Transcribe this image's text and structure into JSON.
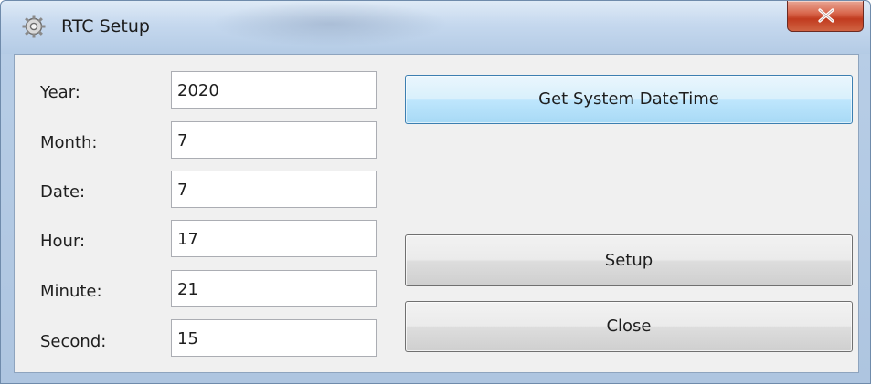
{
  "window": {
    "title": "RTC Setup",
    "app_icon": "gear-icon",
    "close_icon": "close-icon"
  },
  "form": {
    "fields": [
      {
        "label": "Year:",
        "value": "2020"
      },
      {
        "label": "Month:",
        "value": "7"
      },
      {
        "label": "Date:",
        "value": "7"
      },
      {
        "label": "Hour:",
        "value": "17"
      },
      {
        "label": "Minute:",
        "value": "21"
      },
      {
        "label": "Second:",
        "value": "15"
      }
    ]
  },
  "buttons": {
    "get_system_datetime": "Get System DateTime",
    "setup": "Setup",
    "close": "Close"
  },
  "colors": {
    "close_button": "#c9452a",
    "focused_button": "#3c7fb1"
  }
}
